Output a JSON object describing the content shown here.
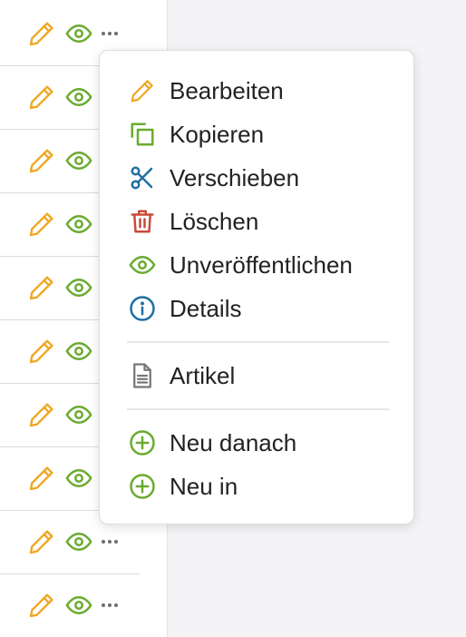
{
  "colors": {
    "edit": "#f0a722",
    "copy": "#6aab2f",
    "move": "#1f6fa3",
    "delete": "#c94a3a",
    "unpublish": "#6aab2f",
    "details": "#1f6fa3",
    "article": "#777777",
    "new": "#6aab2f"
  },
  "list": {
    "rows": [
      {
        "icons": [
          "pencil-icon",
          "eye-icon",
          "more-icon"
        ]
      },
      {
        "icons": [
          "pencil-icon",
          "eye-icon"
        ]
      },
      {
        "icons": [
          "pencil-icon",
          "eye-icon"
        ]
      },
      {
        "icons": [
          "pencil-icon",
          "eye-icon"
        ]
      },
      {
        "icons": [
          "pencil-icon",
          "eye-icon"
        ]
      },
      {
        "icons": [
          "pencil-icon",
          "eye-icon"
        ]
      },
      {
        "icons": [
          "pencil-icon",
          "eye-icon"
        ]
      },
      {
        "icons": [
          "pencil-icon",
          "eye-icon"
        ]
      },
      {
        "icons": [
          "pencil-icon",
          "eye-icon",
          "more-icon"
        ]
      },
      {
        "icons": [
          "pencil-icon",
          "eye-icon",
          "more-icon"
        ]
      }
    ]
  },
  "menu": {
    "items": [
      {
        "label": "Bearbeiten",
        "icon": "pencil-icon"
      },
      {
        "label": "Kopieren",
        "icon": "copy-icon"
      },
      {
        "label": "Verschieben",
        "icon": "scissors-icon"
      },
      {
        "label": "Löschen",
        "icon": "trash-icon"
      },
      {
        "label": "Unveröffentlichen",
        "icon": "eye-icon"
      },
      {
        "label": "Details",
        "icon": "info-icon"
      },
      {
        "label": "Artikel",
        "icon": "document-icon"
      },
      {
        "label": "Neu danach",
        "icon": "plus-circle-icon"
      },
      {
        "label": "Neu in",
        "icon": "plus-circle-icon"
      }
    ]
  }
}
